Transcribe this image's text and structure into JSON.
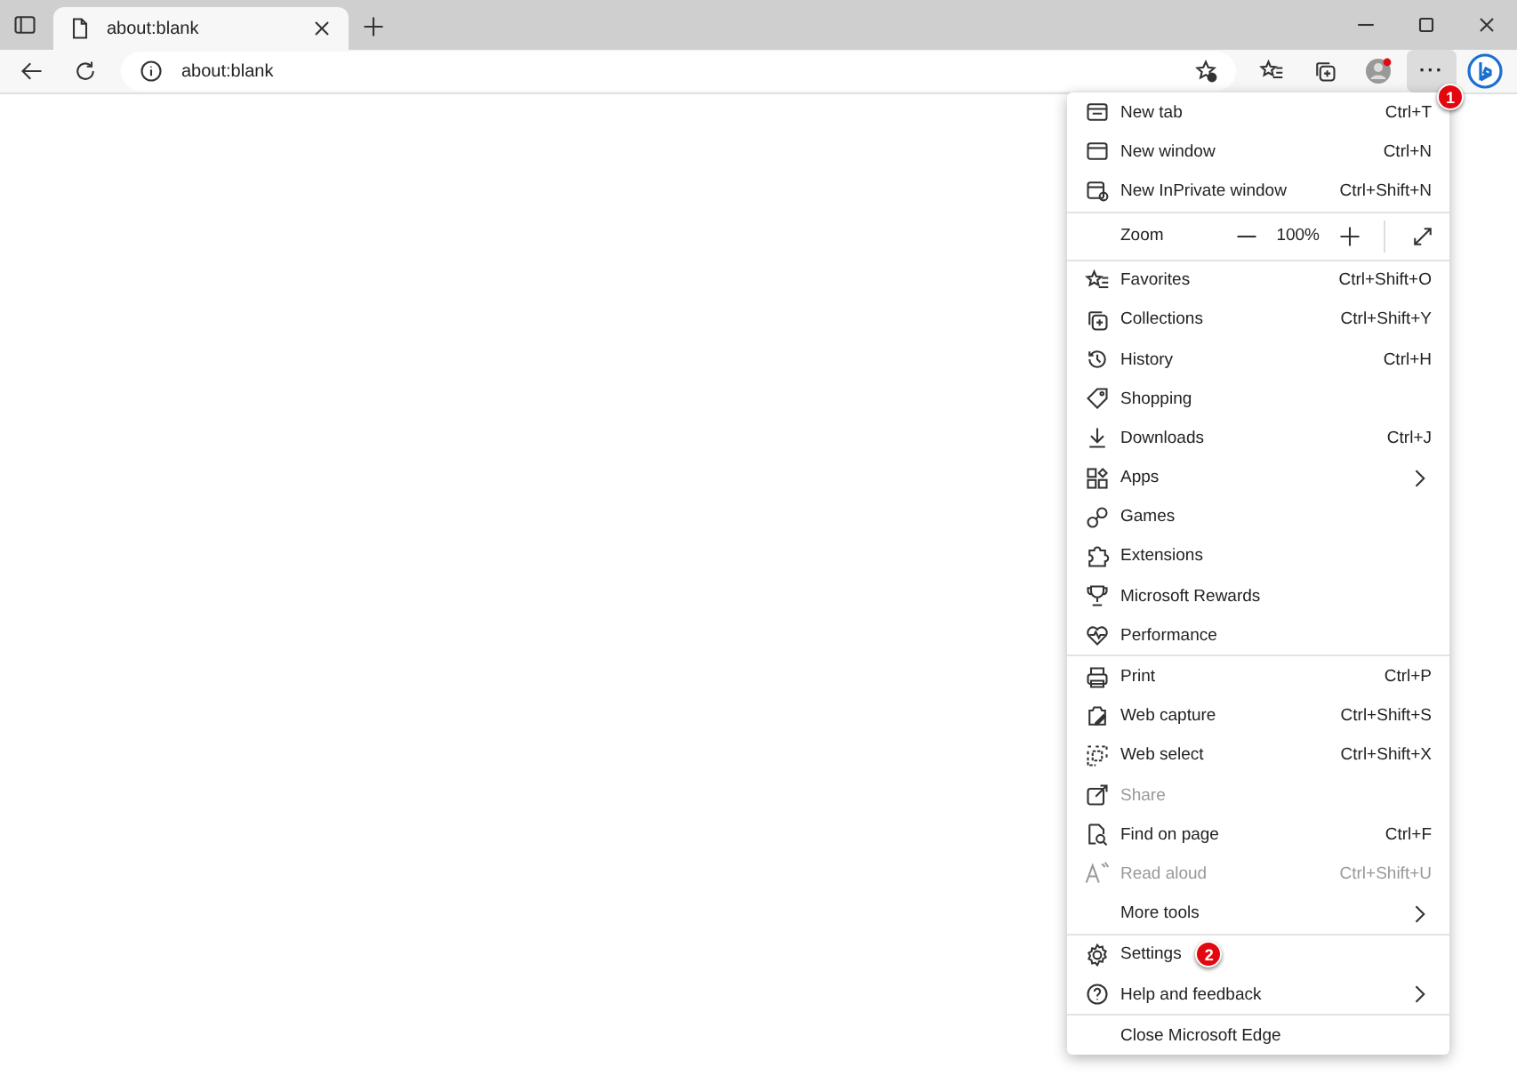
{
  "tab": {
    "title": "about:blank"
  },
  "address_bar": {
    "value": "about:blank"
  },
  "more_button": {
    "label": "···",
    "selected": true,
    "badge": "1"
  },
  "menu": {
    "sections": [
      {
        "items": [
          {
            "label": "New tab",
            "shortcut": "Ctrl+T",
            "submenu": false,
            "disabled": false
          },
          {
            "label": "New window",
            "shortcut": "Ctrl+N",
            "submenu": false,
            "disabled": false
          },
          {
            "label": "New InPrivate window",
            "shortcut": "Ctrl+Shift+N",
            "submenu": false,
            "disabled": false
          }
        ]
      },
      {
        "zoom": {
          "label": "Zoom",
          "value": "100%"
        }
      },
      {
        "items": [
          {
            "label": "Favorites",
            "shortcut": "Ctrl+Shift+O",
            "submenu": false,
            "disabled": false
          },
          {
            "label": "Collections",
            "shortcut": "Ctrl+Shift+Y",
            "submenu": false,
            "disabled": false
          },
          {
            "label": "History",
            "shortcut": "Ctrl+H",
            "submenu": false,
            "disabled": false
          },
          {
            "label": "Shopping",
            "submenu": false,
            "disabled": false
          },
          {
            "label": "Downloads",
            "shortcut": "Ctrl+J",
            "submenu": false,
            "disabled": false
          },
          {
            "label": "Apps",
            "submenu": true,
            "disabled": false
          },
          {
            "label": "Games",
            "submenu": false,
            "disabled": false
          },
          {
            "label": "Extensions",
            "submenu": false,
            "disabled": false
          },
          {
            "label": "Microsoft Rewards",
            "submenu": false,
            "disabled": false
          },
          {
            "label": "Performance",
            "submenu": false,
            "disabled": false
          }
        ]
      },
      {
        "items": [
          {
            "label": "Print",
            "shortcut": "Ctrl+P",
            "submenu": false,
            "disabled": false
          },
          {
            "label": "Web capture",
            "shortcut": "Ctrl+Shift+S",
            "submenu": false,
            "disabled": false
          },
          {
            "label": "Web select",
            "shortcut": "Ctrl+Shift+X",
            "submenu": false,
            "disabled": false
          },
          {
            "label": "Share",
            "submenu": false,
            "disabled": true
          },
          {
            "label": "Find on page",
            "shortcut": "Ctrl+F",
            "submenu": false,
            "disabled": false
          },
          {
            "label": "Read aloud",
            "shortcut": "Ctrl+Shift+U",
            "submenu": false,
            "disabled": true
          },
          {
            "label": "More tools",
            "submenu": true,
            "disabled": false
          }
        ]
      },
      {
        "items": [
          {
            "label": "Settings",
            "submenu": false,
            "disabled": false,
            "badge": "2"
          },
          {
            "label": "Help and feedback",
            "submenu": true,
            "disabled": false
          }
        ]
      },
      {
        "items": [
          {
            "label": "Close Microsoft Edge",
            "submenu": false,
            "disabled": false
          }
        ]
      }
    ]
  }
}
